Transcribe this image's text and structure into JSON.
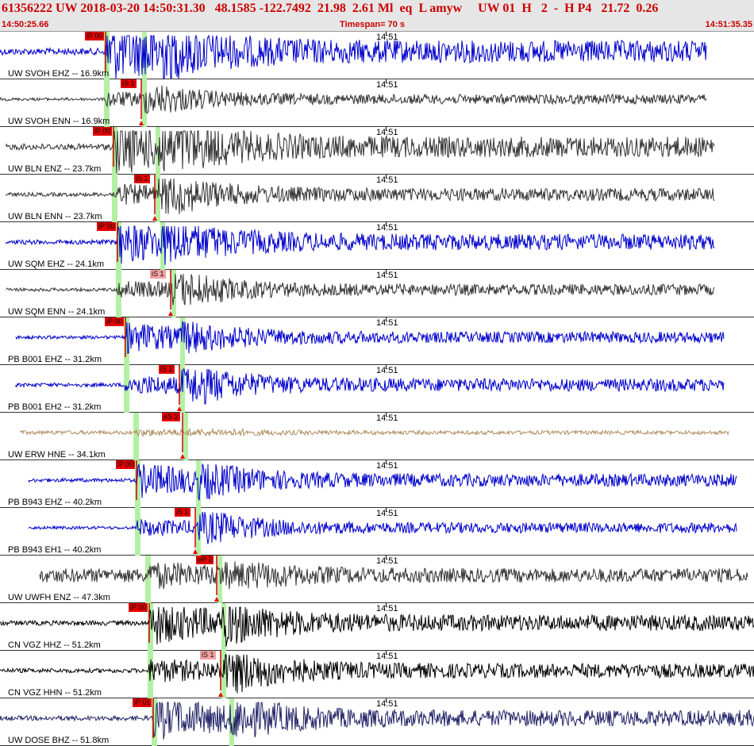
{
  "header": {
    "event_line": "61356222 UW 2018-03-20 14:50:31.30   48.1585 -122.7492  21.98  2.61 Ml  eq  L amyw     UW 01  H   2  -  H P4   21.72  0.26",
    "start_time": "14:50:25.66",
    "timespan": "Timespan=  70 s",
    "end_time": "14:51:35.35"
  },
  "minute_label": "14:51",
  "traces": [
    {
      "label": "UW SVOH EHZ -- 16.9km",
      "color": "#0000cc",
      "pick": "iP 00",
      "pick_light": false
    },
    {
      "label": "UW SVOH ENN -- 16.9km",
      "color": "#333333",
      "pick": "iS 1",
      "pick_light": false
    },
    {
      "label": "UW BLN ENZ -- 23.7km",
      "color": "#333333",
      "pick": "iP 00",
      "pick_light": false
    },
    {
      "label": "UW BLN ENN -- 23.7km",
      "color": "#333333",
      "pick": "iS 1",
      "pick_light": false
    },
    {
      "label": "UW SQM EHZ -- 24.1km",
      "color": "#0000cc",
      "pick": "iP 00",
      "pick_light": false
    },
    {
      "label": "UW SQM ENN -- 24.1km",
      "color": "#333333",
      "pick": "iS 1",
      "pick_light": true
    },
    {
      "label": "PB B001 EHZ -- 31.2km",
      "color": "#0000cc",
      "pick": "iP 00",
      "pick_light": false
    },
    {
      "label": "PB B001 EH2 -- 31.2km",
      "color": "#0000cc",
      "pick": "iS 1",
      "pick_light": false
    },
    {
      "label": "UW ERW HNE -- 34.1km",
      "color": "#b08f62",
      "pick": "eS 2",
      "pick_light": false
    },
    {
      "label": "PB B943 EHZ -- 40.2km",
      "color": "#0000cc",
      "pick": "iP 00",
      "pick_light": false
    },
    {
      "label": "PB B943 EH1 -- 40.2km",
      "color": "#0000cc",
      "pick": "iS 1",
      "pick_light": false
    },
    {
      "label": "UW UWFH ENZ -- 47.3km",
      "color": "#333333",
      "pick": "eP 2",
      "pick_light": false
    },
    {
      "label": "CN VGZ HHZ -- 51.2km",
      "color": "#000000",
      "pick": "iP 00",
      "pick_light": false
    },
    {
      "label": "CN VGZ HHN -- 51.2km",
      "color": "#000000",
      "pick": "iS 1",
      "pick_light": true
    },
    {
      "label": "UW DOSE BHZ -- 51.8km",
      "color": "#222266",
      "pick": "iP 01",
      "pick_light": false
    }
  ]
}
